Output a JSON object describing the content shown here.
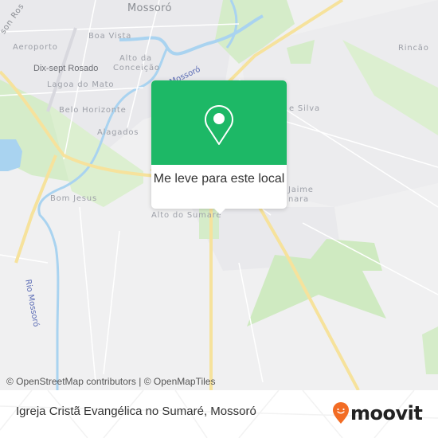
{
  "map": {
    "labels": {
      "city": "Mossoró",
      "boa_vista": "Boa Vista",
      "aeroporto": "Aeroporto",
      "dix_sept_rosado": "Dix-sept Rosado",
      "alto_da_conceicao_1": "Alto da",
      "alto_da_conceicao_2": "Conceição",
      "lagoa_do_mato": "Lagoa do Mato",
      "belo_horizonte": "Belo Horizonte",
      "alagados": "Alagados",
      "bom_jesus": "Bom Jesus",
      "alto_do_sumare": "Alto do Sumaré",
      "rincao": "Rincão",
      "e_silva": "e Silva",
      "jaime_1": "Jaime",
      "jaime_2": "nara",
      "river_mossoro": "Rio Mossoró",
      "river_top": "Mossoró",
      "road_top_left": "son Ros"
    },
    "attribution": "© OpenStreetMap contributors | © OpenMapTiles"
  },
  "popup": {
    "icon": "map-pin-icon",
    "action_label": "Me leve para este local",
    "color": "#1db866"
  },
  "footer": {
    "place_title": "Igreja Cristã Evangélica no Sumaré, Mossoró",
    "brand": "moovit",
    "brand_color": "#f26c24"
  }
}
